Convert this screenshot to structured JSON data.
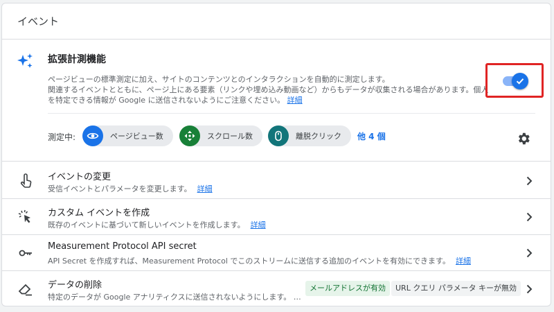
{
  "header": {
    "title": "イベント"
  },
  "enhanced": {
    "title": "拡張計測機能",
    "desc_line1": "ページビューの標準測定に加え、サイトのコンテンツとのインタラクションを自動的に測定します。",
    "desc_line2": "関連するイベントとともに、ページ上にある要素（リンクや埋め込み動画など）からもデータが収集される場合があります。個人",
    "desc_line3": "を特定できる情報が Google に送信されないようにご注意ください。",
    "desc_link": "詳細",
    "toggle_enabled": true,
    "measuring_label": "測定中:",
    "chips": [
      {
        "label": "ページビュー数",
        "icon": "eye-icon",
        "color": "#1a73e8"
      },
      {
        "label": "スクロール数",
        "icon": "scroll-arrows-icon",
        "color": "#188038"
      },
      {
        "label": "離脱クリック",
        "icon": "mouse-icon",
        "color": "#12757a"
      }
    ],
    "more_link": "他 4 個"
  },
  "rows": [
    {
      "title": "イベントの変更",
      "subtitle": "受信イベントとパラメータを変更します。",
      "link": "詳細",
      "icon": "touch-icon"
    },
    {
      "title": "カスタム イベントを作成",
      "subtitle": "既存のイベントに基づいて新しいイベントを作成します。",
      "link": "詳細",
      "icon": "cursor-click-icon"
    },
    {
      "title": "Measurement Protocol API secret",
      "subtitle": "API Secret を作成すれば、Measurement Protocol でこのストリームに送信する追加のイベントを有効にできます。",
      "link": "詳細",
      "icon": "key-icon"
    },
    {
      "title": "データの削除",
      "subtitle": "特定のデータが Google アナリティクスに送信されないようにします。 …",
      "icon": "eraser-icon",
      "tags": [
        "メールアドレスが有効",
        "URL クエリ パラメータ キーが無効"
      ]
    }
  ],
  "colors": {
    "accent": "#1a73e8",
    "highlight": "#e02424",
    "toggle_track": "#8ab4f8"
  }
}
